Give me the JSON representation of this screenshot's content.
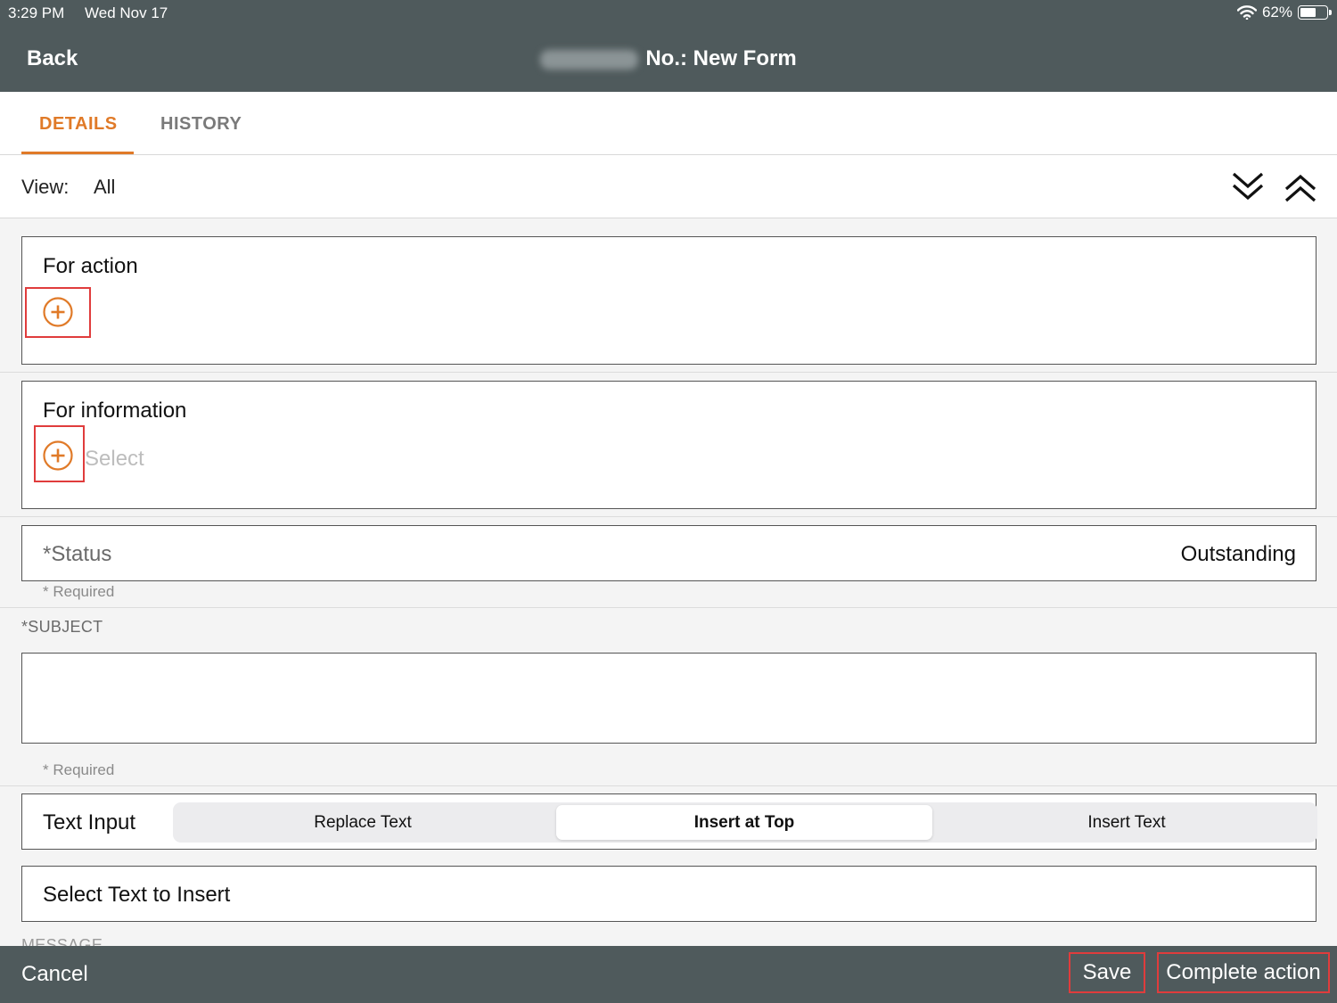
{
  "status_bar": {
    "time": "3:29 PM",
    "date": "Wed Nov 17",
    "battery": "62%",
    "battery_level": 0.62
  },
  "nav": {
    "back_label": "Back",
    "title": "No.: New Form"
  },
  "tabs": [
    {
      "label": "DETAILS",
      "active": true
    },
    {
      "label": "HISTORY",
      "active": false
    }
  ],
  "view": {
    "label": "View:",
    "value": "All"
  },
  "icons": {
    "expand": "double-chevron-down-icon",
    "collapse": "double-chevron-up-icon",
    "add": "plus-circle-icon"
  },
  "colors": {
    "accent": "#e07a28",
    "highlight": "#e03c3c",
    "bar": "#4f5a5c"
  },
  "for_action": {
    "title": "For action"
  },
  "for_information": {
    "title": "For information",
    "placeholder": "Select"
  },
  "status_field": {
    "label": "*Status",
    "value": "Outstanding",
    "required_note": "* Required"
  },
  "subject": {
    "label": "*SUBJECT",
    "value": "",
    "required_note": "* Required"
  },
  "text_input": {
    "label": "Text Input",
    "options": [
      "Replace Text",
      "Insert at Top",
      "Insert Text"
    ],
    "selected": "Insert at Top"
  },
  "insert_text": {
    "label": "Select Text to Insert"
  },
  "message": {
    "label": "MESSAGE"
  },
  "footer": {
    "cancel_label": "Cancel",
    "save_label": "Save",
    "complete_label": "Complete action"
  }
}
